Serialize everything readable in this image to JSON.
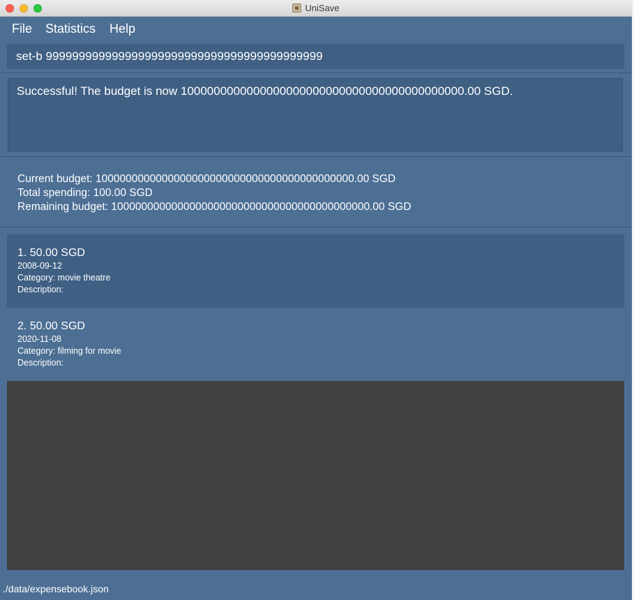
{
  "window": {
    "title": "UniSave"
  },
  "menu": {
    "file": "File",
    "statistics": "Statistics",
    "help": "Help"
  },
  "command": {
    "value": "set-b 999999999999999999999999999999999999999999"
  },
  "result": {
    "text": "Successful! The budget is now 1000000000000000000000000000000000000000000.00 SGD."
  },
  "budget": {
    "current": "Current budget: 1000000000000000000000000000000000000000000.00 SGD",
    "total": "Total spending: 100.00 SGD",
    "remaining": "Remaining budget: 1000000000000000000000000000000000000000000.00 SGD"
  },
  "expenses": [
    {
      "title": "1.  50.00 SGD",
      "date": "2008-09-12",
      "category": "Category: movie theatre",
      "description": "Description:"
    },
    {
      "title": "2.  50.00 SGD",
      "date": "2020-11-08",
      "category": "Category: filming for movie",
      "description": "Description:"
    }
  ],
  "status": {
    "path": "./data/expensebook.json"
  }
}
